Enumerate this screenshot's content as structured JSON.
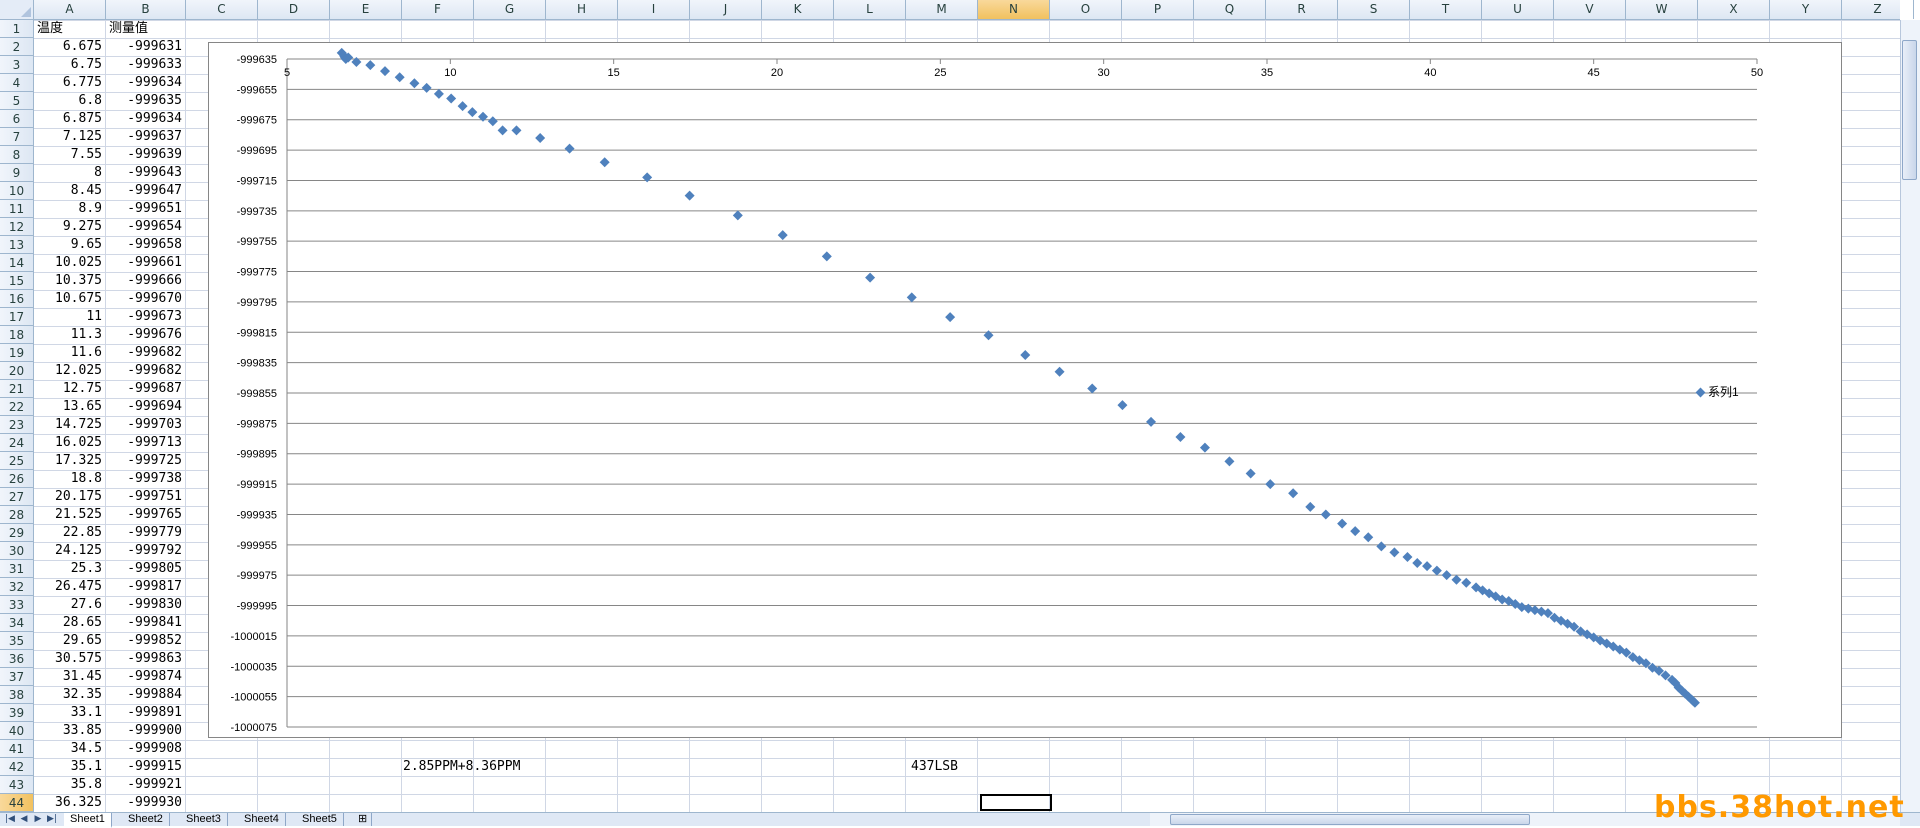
{
  "columns": [
    "A",
    "B",
    "C",
    "D",
    "E",
    "F",
    "G",
    "H",
    "I",
    "J",
    "K",
    "L",
    "M",
    "N",
    "O",
    "P",
    "Q",
    "R",
    "S",
    "T",
    "U",
    "V",
    "W",
    "X",
    "Y",
    "Z"
  ],
  "selected_column": "N",
  "rows_visible": 44,
  "selected_row": 44,
  "header_row": {
    "a": "温度",
    "b": "测量值"
  },
  "table": [
    [
      "6.675",
      "-999631"
    ],
    [
      "6.75",
      "-999633"
    ],
    [
      "6.775",
      "-999634"
    ],
    [
      "6.8",
      "-999635"
    ],
    [
      "6.875",
      "-999634"
    ],
    [
      "7.125",
      "-999637"
    ],
    [
      "7.55",
      "-999639"
    ],
    [
      "8",
      "-999643"
    ],
    [
      "8.45",
      "-999647"
    ],
    [
      "8.9",
      "-999651"
    ],
    [
      "9.275",
      "-999654"
    ],
    [
      "9.65",
      "-999658"
    ],
    [
      "10.025",
      "-999661"
    ],
    [
      "10.375",
      "-999666"
    ],
    [
      "10.675",
      "-999670"
    ],
    [
      "11",
      "-999673"
    ],
    [
      "11.3",
      "-999676"
    ],
    [
      "11.6",
      "-999682"
    ],
    [
      "12.025",
      "-999682"
    ],
    [
      "12.75",
      "-999687"
    ],
    [
      "13.65",
      "-999694"
    ],
    [
      "14.725",
      "-999703"
    ],
    [
      "16.025",
      "-999713"
    ],
    [
      "17.325",
      "-999725"
    ],
    [
      "18.8",
      "-999738"
    ],
    [
      "20.175",
      "-999751"
    ],
    [
      "21.525",
      "-999765"
    ],
    [
      "22.85",
      "-999779"
    ],
    [
      "24.125",
      "-999792"
    ],
    [
      "25.3",
      "-999805"
    ],
    [
      "26.475",
      "-999817"
    ],
    [
      "27.6",
      "-999830"
    ],
    [
      "28.65",
      "-999841"
    ],
    [
      "29.65",
      "-999852"
    ],
    [
      "30.575",
      "-999863"
    ],
    [
      "31.45",
      "-999874"
    ],
    [
      "32.35",
      "-999884"
    ],
    [
      "33.1",
      "-999891"
    ],
    [
      "33.85",
      "-999900"
    ],
    [
      "34.5",
      "-999908"
    ],
    [
      "35.1",
      "-999915"
    ],
    [
      "35.8",
      "-999921"
    ],
    [
      "36.325",
      "-999930"
    ]
  ],
  "notes": {
    "f42": "2.85PPM+8.36PPM",
    "m42": "437LSB"
  },
  "sheets": [
    "Sheet1",
    "Sheet2",
    "Sheet3",
    "Sheet4",
    "Sheet5"
  ],
  "active_sheet": "Sheet1",
  "watermark": "bbs.38hot.net",
  "chart_data": {
    "type": "scatter",
    "series": [
      {
        "name": "系列1",
        "color": "#4f81bd",
        "marker": "diamond",
        "x": [
          6.675,
          6.75,
          6.775,
          6.8,
          6.875,
          7.125,
          7.55,
          8,
          8.45,
          8.9,
          9.275,
          9.65,
          10.025,
          10.375,
          10.675,
          11,
          11.3,
          11.6,
          12.025,
          12.75,
          13.65,
          14.725,
          16.025,
          17.325,
          18.8,
          20.175,
          21.525,
          22.85,
          24.125,
          25.3,
          26.475,
          27.6,
          28.65,
          29.65,
          30.575,
          31.45,
          32.35,
          33.1,
          33.85,
          34.5,
          35.1,
          35.8,
          36.325,
          36.8,
          37.3,
          37.7,
          38.1,
          38.5,
          38.9,
          39.3,
          39.6,
          39.9,
          40.2,
          40.5,
          40.8,
          41.1,
          41.4,
          41.6,
          41.8,
          42.0,
          42.2,
          42.4,
          42.6,
          42.8,
          43.0,
          43.2,
          43.4,
          43.6,
          43.8,
          44.0,
          44.2,
          44.4,
          44.6,
          44.8,
          45.0,
          45.2,
          45.4,
          45.6,
          45.8,
          46.0,
          46.2,
          46.4,
          46.6,
          46.8,
          47.0,
          47.2,
          47.4,
          47.5,
          47.6,
          47.7,
          47.8,
          47.9,
          48.0,
          48.05,
          48.1
        ],
        "y": [
          -999631,
          -999633,
          -999634,
          -999635,
          -999634,
          -999637,
          -999639,
          -999643,
          -999647,
          -999651,
          -999654,
          -999658,
          -999661,
          -999666,
          -999670,
          -999673,
          -999676,
          -999682,
          -999682,
          -999687,
          -999694,
          -999703,
          -999713,
          -999725,
          -999738,
          -999751,
          -999765,
          -999779,
          -999792,
          -999805,
          -999817,
          -999830,
          -999841,
          -999852,
          -999863,
          -999874,
          -999884,
          -999891,
          -999900,
          -999908,
          -999915,
          -999921,
          -999930,
          -999935,
          -999941,
          -999946,
          -999950,
          -999956,
          -999960,
          -999963,
          -999967,
          -999969,
          -999972,
          -999975,
          -999978,
          -999980,
          -999983,
          -999985,
          -999987,
          -999989,
          -999991,
          -999992,
          -999994,
          -999996,
          -999997,
          -999998,
          -999999,
          -1000000,
          -1000003,
          -1000005,
          -1000007,
          -1000009,
          -1000012,
          -1000014,
          -1000016,
          -1000018,
          -1000020,
          -1000022,
          -1000024,
          -1000026,
          -1000029,
          -1000031,
          -1000033,
          -1000036,
          -1000038,
          -1000041,
          -1000044,
          -1000046,
          -1000049,
          -1000051,
          -1000053,
          -1000055,
          -1000057,
          -1000058,
          -1000059
        ]
      }
    ],
    "xlim": [
      5,
      50
    ],
    "ylim": [
      -1000075,
      -999635
    ],
    "x_ticks": [
      5,
      10,
      15,
      20,
      25,
      30,
      35,
      40,
      45,
      50
    ],
    "y_ticks": [
      -999635,
      -999655,
      -999675,
      -999695,
      -999715,
      -999735,
      -999755,
      -999775,
      -999795,
      -999815,
      -999835,
      -999855,
      -999875,
      -999895,
      -999915,
      -999935,
      -999955,
      -999975,
      -999995,
      -1000015,
      -1000035,
      -1000055,
      -1000075
    ],
    "grid": true,
    "legend_position": "right",
    "x_axis_position": "top"
  }
}
